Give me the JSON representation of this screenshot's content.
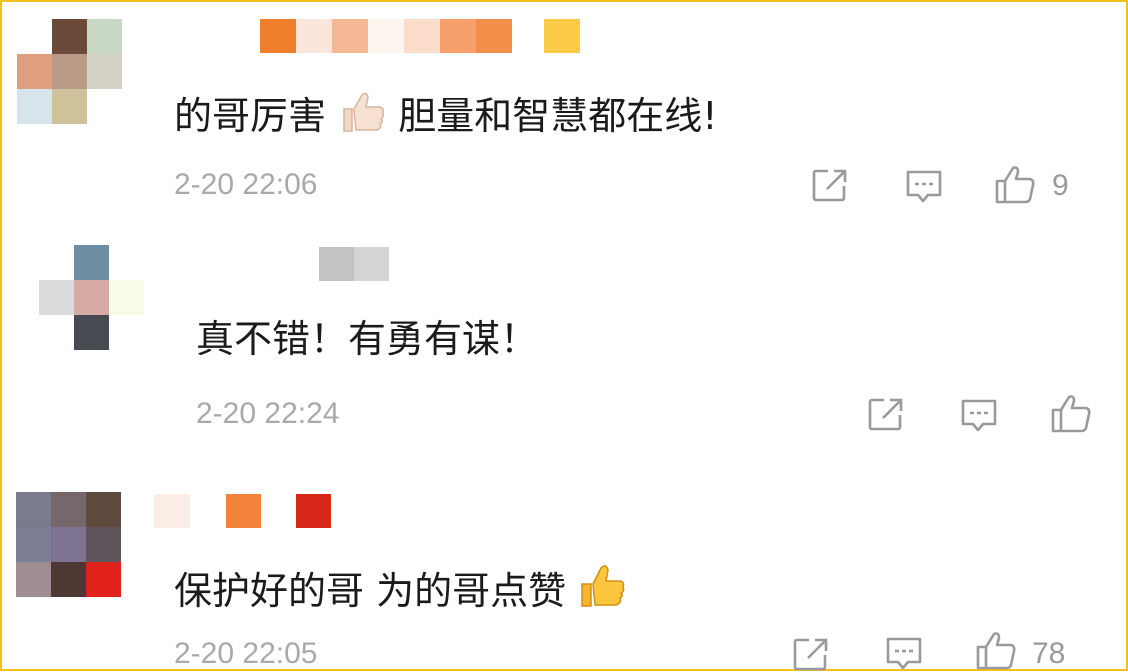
{
  "comments": [
    {
      "text_before": "的哥厉害",
      "emoji": "thumbs-up-light",
      "text_after": "胆量和智慧都在线!",
      "timestamp": "2-20 22:06",
      "like_count": "9",
      "icons": {
        "share": "share-icon",
        "reply": "comment-icon",
        "like": "thumbs-up-icon"
      }
    },
    {
      "text": "真不错！有勇有谋！",
      "timestamp": "2-20 22:24",
      "like_count": "",
      "icons": {
        "share": "share-icon",
        "reply": "comment-icon",
        "like": "thumbs-up-icon"
      }
    },
    {
      "text": "保护好的哥 为的哥点赞",
      "emoji": "thumbs-up-yellow",
      "timestamp": "2-20 22:05",
      "like_count": "78",
      "icons": {
        "share": "share-icon",
        "reply": "comment-icon",
        "like": "thumbs-up-icon"
      }
    }
  ],
  "colors": {
    "border": "#f2c21b",
    "timestamp": "#a9a9a9",
    "icon": "#9a9a9a"
  }
}
